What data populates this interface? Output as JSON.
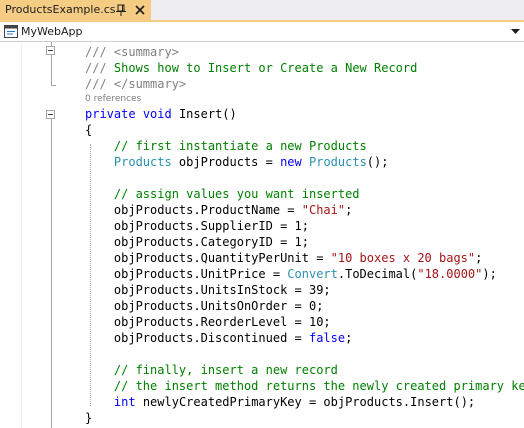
{
  "tab": {
    "title": "ProductsExample.cs",
    "pin_glyph": "⊓",
    "close_glyph": "✕"
  },
  "navbar": {
    "project": "MyWebApp"
  },
  "editor": {
    "references": "0 references",
    "lines": {
      "l1": [
        {
          "t": "/// ",
          "c": "doc"
        },
        {
          "t": "<summary>",
          "c": "doc"
        }
      ],
      "l2": [
        {
          "t": "/// ",
          "c": "doc"
        },
        {
          "t": "Shows how to Insert or Create a New Record",
          "c": "cm"
        }
      ],
      "l3": [
        {
          "t": "/// ",
          "c": "doc"
        },
        {
          "t": "</summary>",
          "c": "doc"
        }
      ],
      "l4": [
        {
          "t": "private",
          "c": "kw"
        },
        {
          "t": " "
        },
        {
          "t": "void",
          "c": "kw"
        },
        {
          "t": " Insert()"
        }
      ],
      "l5": [
        {
          "t": "{"
        }
      ],
      "l6": [
        {
          "t": "    // first instantiate a new Products",
          "c": "cm"
        }
      ],
      "l7": [
        {
          "t": "    "
        },
        {
          "t": "Products",
          "c": "ty"
        },
        {
          "t": " objProducts = "
        },
        {
          "t": "new",
          "c": "kw"
        },
        {
          "t": " "
        },
        {
          "t": "Products",
          "c": "ty"
        },
        {
          "t": "();"
        }
      ],
      "l8": [
        {
          "t": ""
        }
      ],
      "l9": [
        {
          "t": "    // assign values you want inserted",
          "c": "cm"
        }
      ],
      "l10": [
        {
          "t": "    objProducts.ProductName = "
        },
        {
          "t": "\"Chai\"",
          "c": "str"
        },
        {
          "t": ";"
        }
      ],
      "l11": [
        {
          "t": "    objProducts.SupplierID = 1;"
        }
      ],
      "l12": [
        {
          "t": "    objProducts.CategoryID = 1;"
        }
      ],
      "l13": [
        {
          "t": "    objProducts.QuantityPerUnit = "
        },
        {
          "t": "\"10 boxes x 20 bags\"",
          "c": "str"
        },
        {
          "t": ";"
        }
      ],
      "l14": [
        {
          "t": "    objProducts.UnitPrice = "
        },
        {
          "t": "Convert",
          "c": "ty"
        },
        {
          "t": ".ToDecimal("
        },
        {
          "t": "\"18.0000\"",
          "c": "str"
        },
        {
          "t": ");"
        }
      ],
      "l15": [
        {
          "t": "    objProducts.UnitsInStock = 39;"
        }
      ],
      "l16": [
        {
          "t": "    objProducts.UnitsOnOrder = 0;"
        }
      ],
      "l17": [
        {
          "t": "    objProducts.ReorderLevel = 10;"
        }
      ],
      "l18": [
        {
          "t": "    objProducts.Discontinued = "
        },
        {
          "t": "false",
          "c": "kw"
        },
        {
          "t": ";"
        }
      ],
      "l19": [
        {
          "t": ""
        }
      ],
      "l20": [
        {
          "t": "    // finally, insert a new record",
          "c": "cm"
        }
      ],
      "l21": [
        {
          "t": "    // the insert method returns the newly created primary key",
          "c": "cm"
        }
      ],
      "l22": [
        {
          "t": "    "
        },
        {
          "t": "int",
          "c": "kw"
        },
        {
          "t": " newlyCreatedPrimaryKey = objProducts.Insert();"
        }
      ],
      "l23": [
        {
          "t": "}"
        }
      ]
    }
  }
}
